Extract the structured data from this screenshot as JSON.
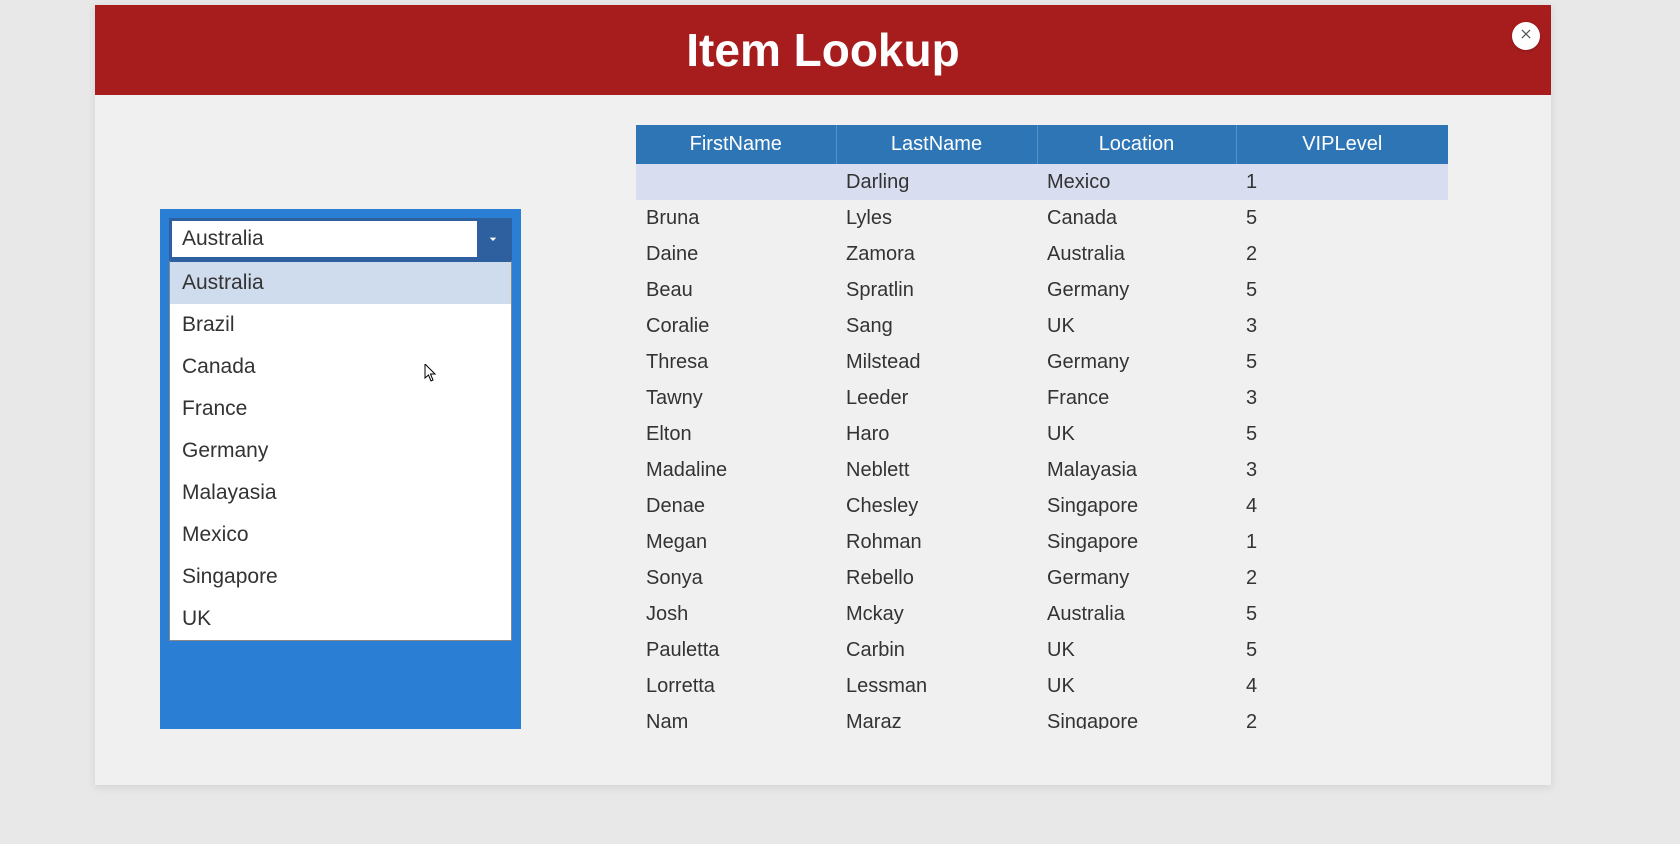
{
  "header": {
    "title": "Item Lookup"
  },
  "dropdown": {
    "selected": "Australia",
    "options": [
      "Australia",
      "Brazil",
      "Canada",
      "France",
      "Germany",
      "Malayasia",
      "Mexico",
      "Singapore",
      "UK"
    ]
  },
  "table": {
    "columns": [
      "FirstName",
      "LastName",
      "Location",
      "VIPLevel"
    ],
    "rows": [
      {
        "first": "",
        "last": "Darling",
        "loc": "Mexico",
        "vip": "1"
      },
      {
        "first": "Bruna",
        "last": "Lyles",
        "loc": "Canada",
        "vip": "5"
      },
      {
        "first": "Daine",
        "last": "Zamora",
        "loc": "Australia",
        "vip": "2"
      },
      {
        "first": "Beau",
        "last": "Spratlin",
        "loc": "Germany",
        "vip": "5"
      },
      {
        "first": "Coralie",
        "last": "Sang",
        "loc": "UK",
        "vip": "3"
      },
      {
        "first": "Thresa",
        "last": "Milstead",
        "loc": "Germany",
        "vip": "5"
      },
      {
        "first": "Tawny",
        "last": "Leeder",
        "loc": "France",
        "vip": "3"
      },
      {
        "first": "Elton",
        "last": "Haro",
        "loc": "UK",
        "vip": "5"
      },
      {
        "first": "Madaline",
        "last": "Neblett",
        "loc": "Malayasia",
        "vip": "3"
      },
      {
        "first": "Denae",
        "last": "Chesley",
        "loc": "Singapore",
        "vip": "4"
      },
      {
        "first": "Megan",
        "last": "Rohman",
        "loc": "Singapore",
        "vip": "1"
      },
      {
        "first": "Sonya",
        "last": "Rebello",
        "loc": "Germany",
        "vip": "2"
      },
      {
        "first": "Josh",
        "last": "Mckay",
        "loc": "Australia",
        "vip": "5"
      },
      {
        "first": "Pauletta",
        "last": "Carbin",
        "loc": "UK",
        "vip": "5"
      },
      {
        "first": "Lorretta",
        "last": "Lessman",
        "loc": "UK",
        "vip": "4"
      },
      {
        "first": "Nam",
        "last": "Maraz",
        "loc": "Singapore",
        "vip": "2"
      }
    ],
    "highlighted_row_index": 0
  }
}
